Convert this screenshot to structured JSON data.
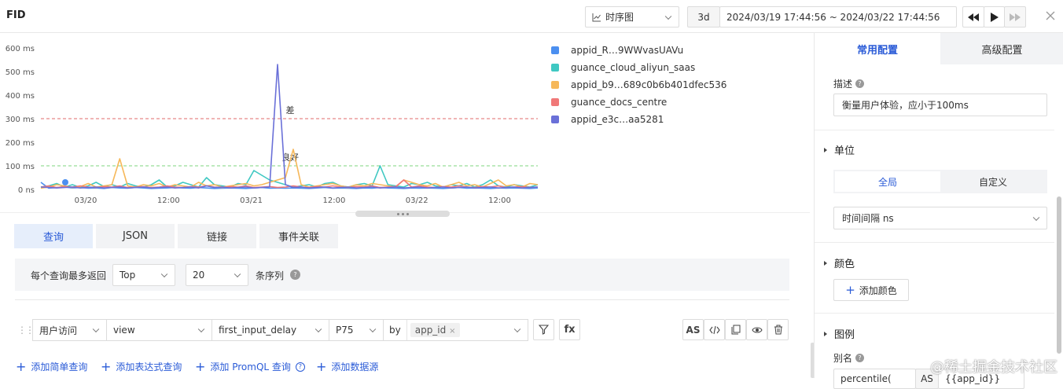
{
  "header": {
    "title": "FID",
    "chart_type_label": "时序图",
    "range_short": "3d",
    "range_text": "2024/03/19 17:44:56 ~ 2024/03/22 17:44:56",
    "prev_icon": "rewind-icon",
    "play_icon": "play-icon",
    "next_icon": "fast-forward-icon",
    "close_icon": "close-icon"
  },
  "chart_data": {
    "type": "line",
    "yticks": [
      "600 ms",
      "500 ms",
      "400 ms",
      "300 ms",
      "200 ms",
      "100 ms",
      "0 ns"
    ],
    "xticks": [
      "03/20",
      "12:00",
      "03/21",
      "12:00",
      "03/22",
      "12:00"
    ],
    "ylim": [
      0,
      600
    ],
    "grid": false,
    "legend_position": "right",
    "thresholds": [
      {
        "label": "差",
        "value": 300,
        "color": "#e06b6b"
      },
      {
        "label": "良好",
        "value": 100,
        "color": "#7ed47e"
      }
    ],
    "series": [
      {
        "name": "appid_R…9WWvasUAVu",
        "color": "#4b8ff0",
        "values": [
          30,
          5,
          8,
          10,
          6,
          8,
          5,
          6,
          4,
          8,
          6,
          5,
          8,
          6,
          4,
          5,
          6,
          8,
          6,
          5,
          8,
          6,
          4,
          5,
          6,
          5,
          4,
          6,
          8,
          5,
          6,
          5,
          6,
          5,
          4,
          6,
          8,
          5,
          6,
          5,
          4,
          6,
          5,
          8,
          6,
          5,
          4,
          6,
          5,
          6,
          5,
          4,
          6,
          8,
          5,
          6,
          5,
          4,
          6,
          5,
          6,
          5,
          4,
          6
        ]
      },
      {
        "name": "guance_cloud_aliyun_saas",
        "color": "#3fc8c2",
        "values": [
          10,
          15,
          25,
          10,
          20,
          8,
          15,
          30,
          12,
          20,
          10,
          25,
          15,
          10,
          20,
          40,
          10,
          15,
          30,
          20,
          10,
          50,
          20,
          15,
          10,
          25,
          20,
          80,
          60,
          40,
          30,
          20,
          10,
          15,
          20,
          10,
          25,
          30,
          15,
          10,
          20,
          25,
          15,
          100,
          20,
          15,
          10,
          25,
          20,
          30,
          15,
          10,
          20,
          15,
          25,
          10,
          20,
          40,
          15,
          10,
          20,
          15,
          10,
          20
        ]
      },
      {
        "name": "appid_b9…689c0b6b401dfec536",
        "color": "#f6b85a",
        "values": [
          5,
          10,
          20,
          15,
          8,
          12,
          25,
          10,
          15,
          20,
          130,
          15,
          10,
          20,
          15,
          25,
          10,
          20,
          15,
          10,
          30,
          15,
          20,
          10,
          15,
          20,
          25,
          15,
          20,
          30,
          40,
          50,
          170,
          20,
          10,
          15,
          20,
          25,
          15,
          10,
          20,
          15,
          25,
          20,
          15,
          10,
          40,
          30,
          20,
          15,
          25,
          10,
          20,
          30,
          15,
          20,
          10,
          25,
          40,
          15,
          20,
          10,
          25,
          20
        ]
      },
      {
        "name": "guance_docs_centre",
        "color": "#f07878",
        "values": [
          10,
          15,
          8,
          12,
          10,
          15,
          10,
          8,
          12,
          10,
          15,
          8,
          10,
          12,
          8,
          10,
          15,
          10,
          8,
          12,
          10,
          15,
          10,
          8,
          12,
          10,
          15,
          8,
          10,
          12,
          8,
          10,
          15,
          10,
          8,
          12,
          10,
          15,
          10,
          8,
          12,
          10,
          15,
          8,
          10,
          12,
          40,
          10,
          15,
          10,
          8,
          12,
          10,
          15,
          10,
          8,
          12,
          10,
          15,
          8,
          10,
          12,
          8,
          10
        ]
      },
      {
        "name": "appid_e3c…aa5281",
        "color": "#6a70d8",
        "values": [
          10,
          8,
          6,
          8,
          10,
          6,
          8,
          10,
          6,
          8,
          10,
          6,
          8,
          10,
          6,
          8,
          10,
          6,
          8,
          10,
          6,
          15,
          8,
          10,
          6,
          8,
          10,
          6,
          8,
          10,
          530,
          20,
          8,
          10,
          6,
          8,
          10,
          6,
          8,
          10,
          6,
          8,
          10,
          6,
          8,
          10,
          6,
          8,
          10,
          6,
          8,
          10,
          6,
          8,
          10,
          6,
          8,
          10,
          6,
          8,
          10,
          6,
          8,
          10
        ]
      }
    ]
  },
  "query_tabs": [
    {
      "label": "查询",
      "active": true
    },
    {
      "label": "JSON",
      "active": false
    },
    {
      "label": "链接",
      "active": false
    },
    {
      "label": "事件关联",
      "active": false
    }
  ],
  "limit": {
    "label": "每个查询最多返回",
    "mode": "Top",
    "count": "20",
    "suffix": "条序列"
  },
  "query": {
    "source": "用户访问",
    "measurement": "view",
    "field": "first_input_delay",
    "agg": "P75",
    "by_label": "by",
    "by_tag": "app_id",
    "filter_icon": "filter-icon",
    "fx_label": "fx",
    "as_label": "AS",
    "code_icon": "code-icon",
    "copy_icon": "copy-icon",
    "eye_icon": "eye-icon",
    "delete_icon": "trash-icon"
  },
  "add_links": [
    "添加简单查询",
    "添加表达式查询",
    "添加 PromQL 查询",
    "添加数据源"
  ],
  "right_panel": {
    "tab_common": "常用配置",
    "tab_advanced": "高级配置",
    "desc_label": "描述",
    "desc_value": "衡量用户体验，应小于100ms",
    "unit_label": "单位",
    "unit_global": "全局",
    "unit_custom": "自定义",
    "unit_value": "时间间隔 ns",
    "color_label": "颜色",
    "add_color": "添加颜色",
    "legend_label": "图例",
    "alias_label": "别名",
    "alias_func": "percentile(",
    "alias_as": "AS",
    "alias_value": "{{app_id}}"
  },
  "watermark": "@稀土掘金技术社区",
  "accent_color": "#2a5bd7"
}
